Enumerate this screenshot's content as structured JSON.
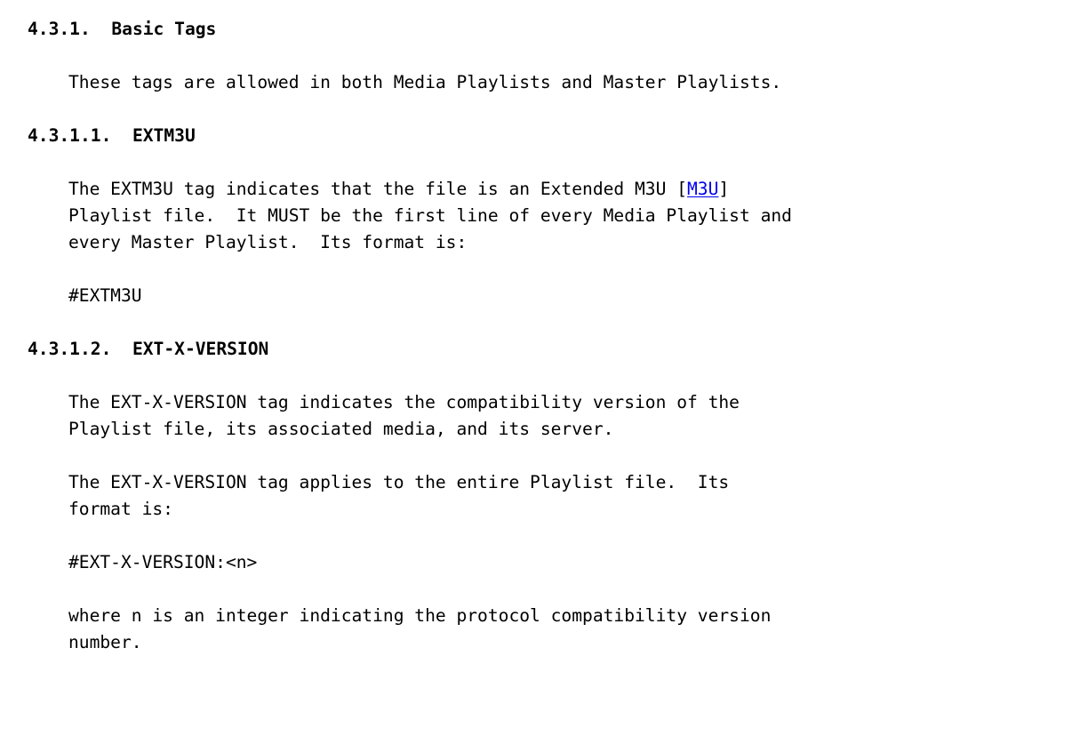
{
  "document": {
    "type": "rfc-specification-text",
    "background_color": "#ffffff",
    "text_color": "#000000",
    "link_color": "#0000ee"
  },
  "sections": {
    "basic_tags": {
      "number": "4.3.1.",
      "title": "Basic Tags",
      "heading": "4.3.1.  Basic Tags",
      "intro_paragraph": "These tags are allowed in both Media Playlists and Master Playlists."
    },
    "extm3u": {
      "number": "4.3.1.1.",
      "title": "EXTM3U",
      "heading": "4.3.1.1.  EXTM3U",
      "paragraph_line_1_before_link": "The EXTM3U tag indicates that the file is an Extended M3U [",
      "link_label": "M3U",
      "paragraph_line_1_after_link": "]",
      "paragraph_line_2": "Playlist file.  It MUST be the first line of every Media Playlist and",
      "paragraph_line_3": "every Master Playlist.  Its format is:",
      "code_example": "#EXTM3U"
    },
    "ext_x_version": {
      "number": "4.3.1.2.",
      "title": "EXT-X-VERSION",
      "heading": "4.3.1.2.  EXT-X-VERSION",
      "paragraph_1_line_1": "The EXT-X-VERSION tag indicates the compatibility version of the",
      "paragraph_1_line_2": "Playlist file, its associated media, and its server.",
      "paragraph_2_line_1": "The EXT-X-VERSION tag applies to the entire Playlist file.  Its",
      "paragraph_2_line_2": "format is:",
      "code_example": "#EXT-X-VERSION:<n>",
      "paragraph_3_line_1": "where n is an integer indicating the protocol compatibility version",
      "paragraph_3_line_2": "number."
    }
  }
}
